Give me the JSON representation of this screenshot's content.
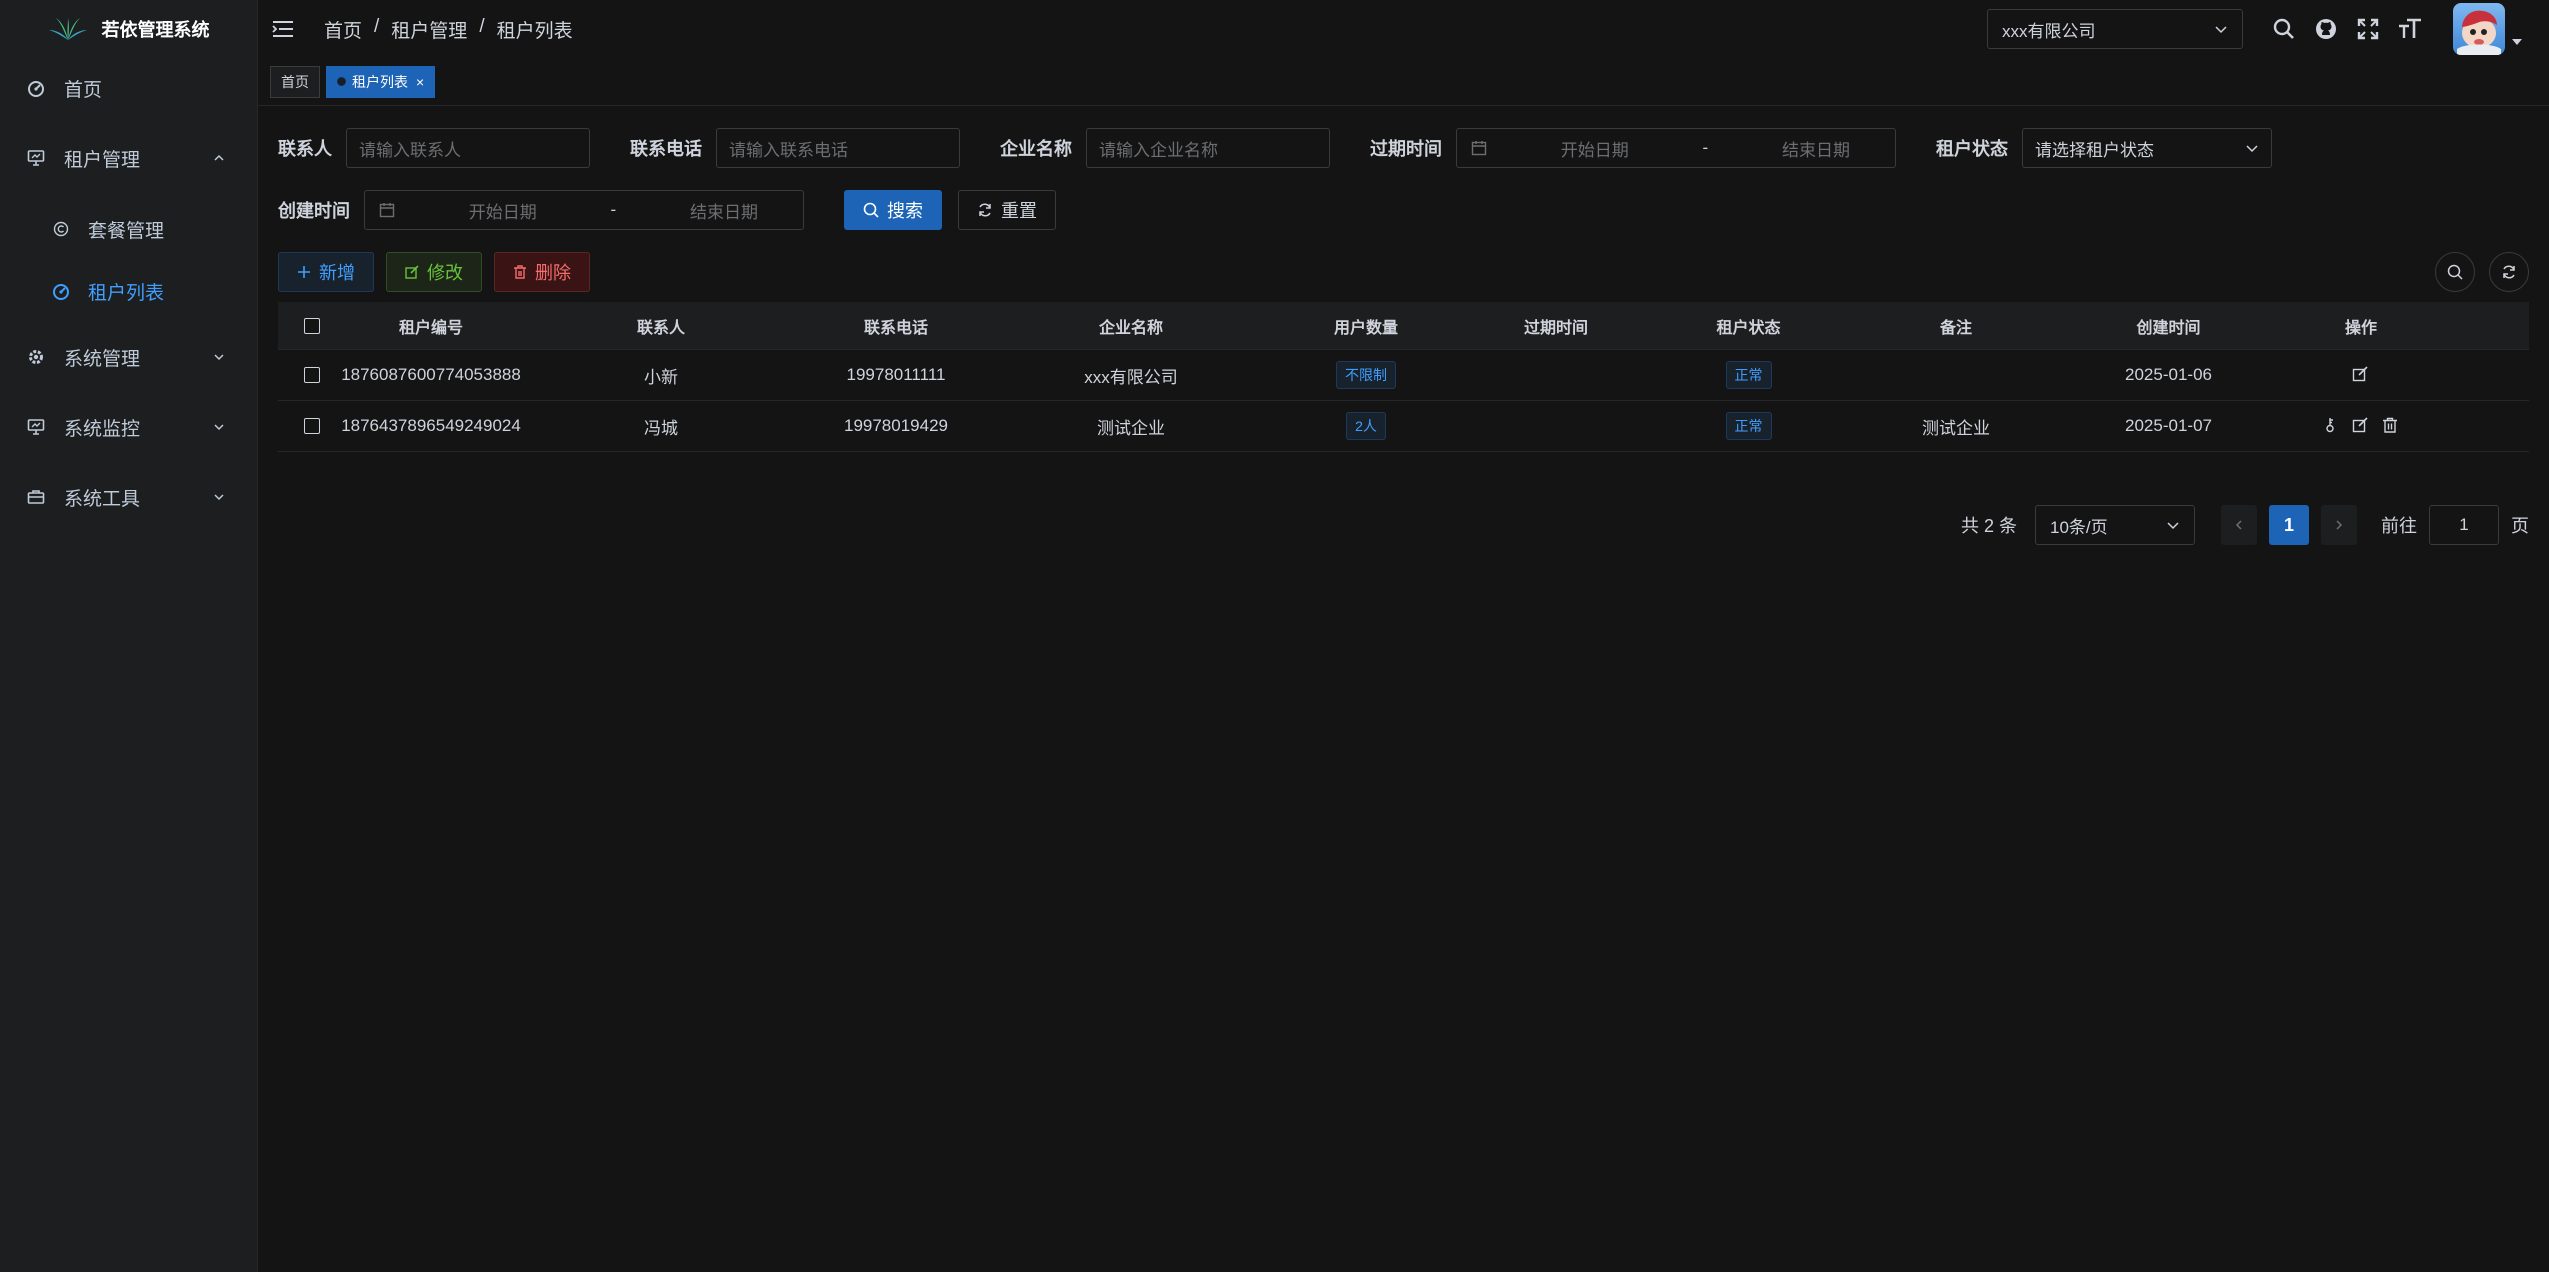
{
  "app": {
    "title": "若依管理系统"
  },
  "sidebar": {
    "items": [
      {
        "label": "首页",
        "icon": "dashboard-icon"
      },
      {
        "label": "租户管理",
        "icon": "monitor-icon",
        "expanded": true,
        "children": [
          {
            "label": "套餐管理",
            "icon": "copyright-icon"
          },
          {
            "label": "租户列表",
            "icon": "dashboard-icon",
            "active": true
          }
        ]
      },
      {
        "label": "系统管理",
        "icon": "gear-icon"
      },
      {
        "label": "系统监控",
        "icon": "monitor-icon"
      },
      {
        "label": "系统工具",
        "icon": "toolbox-icon"
      }
    ]
  },
  "header": {
    "breadcrumb": [
      "首页",
      "租户管理",
      "租户列表"
    ],
    "tenant_select": "xxx有限公司"
  },
  "tags": [
    {
      "label": "首页",
      "active": false
    },
    {
      "label": "租户列表",
      "active": true
    }
  ],
  "search_form": {
    "contact_label": "联系人",
    "contact_placeholder": "请输入联系人",
    "phone_label": "联系电话",
    "phone_placeholder": "请输入联系电话",
    "company_label": "企业名称",
    "company_placeholder": "请输入企业名称",
    "expire_label": "过期时间",
    "expire_start": "开始日期",
    "expire_end": "结束日期",
    "status_label": "租户状态",
    "status_placeholder": "请选择租户状态",
    "created_label": "创建时间",
    "created_start": "开始日期",
    "created_end": "结束日期",
    "range_sep": "-",
    "search_button": "搜索",
    "reset_button": "重置"
  },
  "toolbar": {
    "add": "新增",
    "edit": "修改",
    "delete": "删除"
  },
  "table": {
    "columns": [
      "租户编号",
      "联系人",
      "联系电话",
      "企业名称",
      "用户数量",
      "过期时间",
      "租户状态",
      "备注",
      "创建时间",
      "操作"
    ],
    "rows": [
      {
        "id": "1876087600774053888",
        "contact": "小新",
        "phone": "19978011111",
        "company": "xxx有限公司",
        "users": "不限制",
        "expire": "",
        "status": "正常",
        "remark": "",
        "created": "2025-01-06"
      },
      {
        "id": "1876437896549249024",
        "contact": "冯城",
        "phone": "19978019429",
        "company": "测试企业",
        "users": "2人",
        "expire": "",
        "status": "正常",
        "remark": "测试企业",
        "created": "2025-01-07"
      }
    ]
  },
  "pagination": {
    "total": "共 2 条",
    "page_size": "10条/页",
    "current_page": "1",
    "goto_label": "前往",
    "goto_value": "1",
    "page_suffix": "页"
  },
  "colors": {
    "accent": "#1d64b6",
    "link": "#409eff",
    "success": "#67c23a",
    "danger": "#f56c6c"
  }
}
